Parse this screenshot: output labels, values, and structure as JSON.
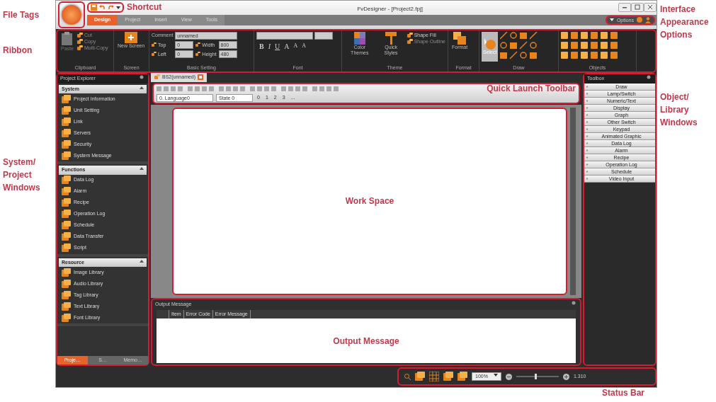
{
  "annotations": {
    "file_tags": "File Tags",
    "shortcut": "Shortcut",
    "ribbon": "Ribbon",
    "interface_options": "Interface Appearance Options",
    "object_library": "Object/ Library Windows",
    "system_project": "System/ Project Windows",
    "quick_launch": "Quick Launch Toolbar",
    "work_space": "Work Space",
    "output_message": "Output Message",
    "status_bar": "Status Bar"
  },
  "window": {
    "title": "FvDesigner - [Project2.fpj]"
  },
  "ribbon_tabs": [
    {
      "label": "Design",
      "selected": true
    },
    {
      "label": "Project",
      "selected": false
    },
    {
      "label": "Insert",
      "selected": false
    },
    {
      "label": "View",
      "selected": false
    },
    {
      "label": "Tools",
      "selected": false
    }
  ],
  "options": {
    "label": "Options"
  },
  "ribbon_groups": [
    {
      "kind": "clipboard",
      "label": "Clipboard",
      "large": "Paste",
      "small": [
        {
          "label": "Cut",
          "disabled": true
        },
        {
          "label": "Copy",
          "disabled": true
        },
        {
          "label": "Multi-Copy",
          "disabled": true
        }
      ]
    },
    {
      "kind": "screen",
      "label": "Screen",
      "large": "New Screen"
    },
    {
      "kind": "basic",
      "label": "Basic Setting",
      "comment_label": "Comment",
      "comment": "unnamed",
      "fields": [
        {
          "label": "Top",
          "value": "0"
        },
        {
          "label": "Width",
          "value": "800"
        },
        {
          "label": "Left",
          "value": "0"
        },
        {
          "label": "Height",
          "value": "480"
        }
      ]
    },
    {
      "kind": "font",
      "label": "Font",
      "buttons": [
        "B",
        "I",
        "U",
        "A",
        "A",
        "A"
      ]
    },
    {
      "kind": "theme",
      "label": "Theme",
      "large": [
        "Color Themes",
        "Quick Styles"
      ],
      "small": [
        {
          "label": "Shape Fill",
          "disabled": false
        },
        {
          "label": "Shape Outline",
          "disabled": true
        }
      ]
    },
    {
      "kind": "format",
      "label": "Format",
      "large": "Format"
    },
    {
      "kind": "draw",
      "label": "Draw",
      "large": "Select"
    },
    {
      "kind": "objects",
      "label": "Objects"
    }
  ],
  "project_explorer": {
    "title": "Project Explorer",
    "sections": [
      {
        "title": "System",
        "items": [
          "Project Information",
          "Unit Setting",
          "Link",
          "Servers",
          "Security",
          "System Message"
        ]
      },
      {
        "title": "Functions",
        "items": [
          "Data Log",
          "Alarm",
          "Recipe",
          "Operation Log",
          "Schedule",
          "Data Transfer",
          "Script"
        ]
      },
      {
        "title": "Resource",
        "items": [
          "Image Library",
          "Audio Library",
          "Tag Library",
          "Text Library",
          "Font Library"
        ]
      }
    ],
    "tabs": [
      {
        "label": "Proje…",
        "selected": true
      },
      {
        "label": "S…",
        "selected": false
      },
      {
        "label": "Memo…",
        "selected": false
      }
    ]
  },
  "document_tab": {
    "label": "BS2(unnamed)"
  },
  "language": {
    "value": "0. Language0"
  },
  "state": {
    "value": "State 0"
  },
  "state_buttons": [
    "0",
    "1",
    "2",
    "3",
    "..."
  ],
  "output": {
    "title": "Output Message",
    "columns": [
      "Item",
      "Error Code",
      "Error Message"
    ]
  },
  "toolbox": {
    "title": "Toolbox",
    "items": [
      "Draw",
      "Lamp/Switch",
      "Numeric/Text",
      "Display",
      "Graph",
      "Other Switch",
      "Keypad",
      "Animated Graphic",
      "Data Log",
      "Alarm",
      "Recipe",
      "Operation Log",
      "Schedule",
      "Video Input"
    ]
  },
  "status_bar": {
    "zoom": "100%",
    "level": 0.45,
    "reading": "1.310"
  }
}
